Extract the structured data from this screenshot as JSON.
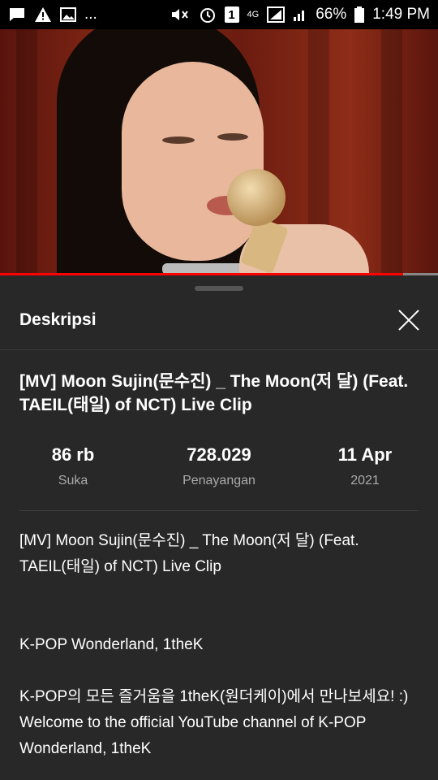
{
  "statusbar": {
    "network": "4G",
    "battery": "66%",
    "time": "1:49 PM",
    "ellipsis": "...",
    "sim": "1"
  },
  "player": {
    "progress": 0.92,
    "progress_color": "#ff0000"
  },
  "panel": {
    "title": "Deskripsi",
    "video_title": "[MV] Moon Sujin(문수진) _ The Moon(저 달) (Feat. TAEIL(태일) of NCT) Live Clip",
    "stats": [
      {
        "value": "86 rb",
        "label": "Suka"
      },
      {
        "value": "728.029",
        "label": "Penayangan"
      },
      {
        "value": "11 Apr",
        "label": "2021"
      }
    ],
    "description": {
      "line1": "[MV] Moon Sujin(문수진) _ The Moon(저 달) (Feat. TAEIL(태일) of NCT) Live Clip",
      "line2": "K-POP Wonderland, 1theK",
      "line3": "K-POP의 모든 즐거움을 1theK(원더케이)에서 만나보세요! :)",
      "line4": "Welcome to the official YouTube channel of K-POP Wonderland, 1theK"
    }
  }
}
